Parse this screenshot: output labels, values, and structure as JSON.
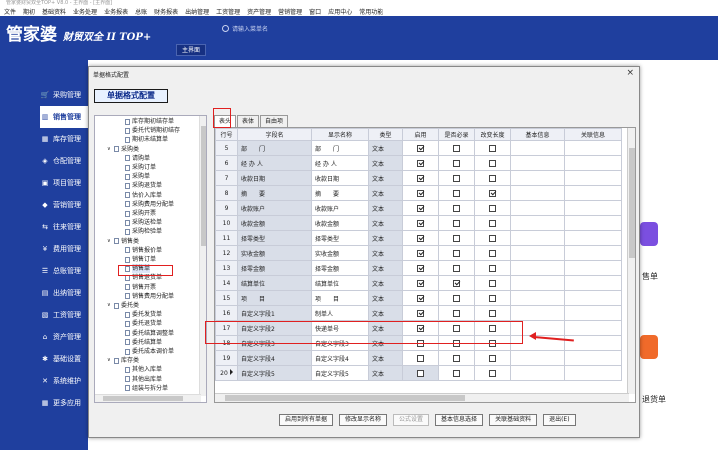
{
  "app": {
    "title": "管家婆财贸双全TOP+ V8.0 - 主界面 - [主界面]",
    "menu": [
      "文件",
      "期初",
      "基础资料",
      "业务处理",
      "业务报表",
      "总账",
      "财务报表",
      "出纳管理",
      "工资管理",
      "资产管理",
      "营销管理",
      "窗口",
      "应用中心",
      "常用功能"
    ],
    "logo": "管家婆",
    "logo_sub": "财贸双全 II TOP+",
    "search_placeholder": "请输入菜单名",
    "main_tab": "主界面"
  },
  "sidebar": {
    "items": [
      {
        "label": "采购管理",
        "icon": "cart-icon"
      },
      {
        "label": "销售管理",
        "icon": "chart-icon",
        "active": true
      },
      {
        "label": "库存管理",
        "icon": "box-icon"
      },
      {
        "label": "仓配管理",
        "icon": "warehouse-icon"
      },
      {
        "label": "项目管理",
        "icon": "project-icon"
      },
      {
        "label": "营销管理",
        "icon": "tag-icon"
      },
      {
        "label": "往来管理",
        "icon": "exchange-icon"
      },
      {
        "label": "费用管理",
        "icon": "money-icon"
      },
      {
        "label": "总账管理",
        "icon": "ledger-icon"
      },
      {
        "label": "出纳管理",
        "icon": "cashier-icon"
      },
      {
        "label": "工资管理",
        "icon": "salary-icon"
      },
      {
        "label": "资产管理",
        "icon": "asset-icon"
      },
      {
        "label": "基础设置",
        "icon": "settings-icon"
      },
      {
        "label": "系统维护",
        "icon": "tools-icon"
      },
      {
        "label": "更多应用",
        "icon": "grid-icon"
      }
    ]
  },
  "right_tiles": [
    {
      "label": "售单",
      "color": "#7b4fe0"
    },
    {
      "label": "退货单",
      "color": "#f06a2a"
    }
  ],
  "dialog": {
    "title": "单据格式配置",
    "header": "单据格式配置",
    "tabs": [
      "表头",
      "表体",
      "自由项"
    ],
    "tree": [
      {
        "label": "库存期初结存单",
        "level": 2
      },
      {
        "label": "委托代销期初结存",
        "level": 2
      },
      {
        "label": "期初未结算单",
        "level": 2
      },
      {
        "label": "采购类",
        "level": 1,
        "folder": true
      },
      {
        "label": "请购单",
        "level": 2
      },
      {
        "label": "采购订单",
        "level": 2
      },
      {
        "label": "采购单",
        "level": 2
      },
      {
        "label": "采购退货单",
        "level": 2
      },
      {
        "label": "估价入库单",
        "level": 2
      },
      {
        "label": "采购费用分配单",
        "level": 2
      },
      {
        "label": "采购开票",
        "level": 2
      },
      {
        "label": "采购送检单",
        "level": 2
      },
      {
        "label": "采购检验单",
        "level": 2
      },
      {
        "label": "销售类",
        "level": 1,
        "folder": true
      },
      {
        "label": "销售报价单",
        "level": 2
      },
      {
        "label": "销售订单",
        "level": 2
      },
      {
        "label": "销售单",
        "level": 2,
        "selected": true
      },
      {
        "label": "销售退货单",
        "level": 2
      },
      {
        "label": "销售开票",
        "level": 2
      },
      {
        "label": "销售费用分配单",
        "level": 2
      },
      {
        "label": "委托类",
        "level": 1,
        "folder": true
      },
      {
        "label": "委托发货单",
        "level": 2
      },
      {
        "label": "委托退货单",
        "level": 2
      },
      {
        "label": "委托结算调整单",
        "level": 2
      },
      {
        "label": "委托结算单",
        "level": 2
      },
      {
        "label": "委托成本调价单",
        "level": 2
      },
      {
        "label": "库存类",
        "level": 1,
        "folder": true
      },
      {
        "label": "其他入库单",
        "level": 2
      },
      {
        "label": "其他出库单",
        "level": 2
      },
      {
        "label": "组装与拆分单",
        "level": 2
      }
    ],
    "columns": [
      "行号",
      "字段名",
      "显示名称",
      "类型",
      "启用",
      "是否必录",
      "改变长度",
      "基本信息",
      "关联信息"
    ],
    "rows": [
      {
        "no": "5",
        "field": "部　　门",
        "display": "部　　门",
        "type": "文本",
        "enabled": true,
        "required": false,
        "len": false
      },
      {
        "no": "6",
        "field": "经 办 人",
        "display": "经 办 人",
        "type": "文本",
        "enabled": true,
        "required": false,
        "len": false
      },
      {
        "no": "7",
        "field": "收款日期",
        "display": "收款日期",
        "type": "文本",
        "enabled": true,
        "required": false,
        "len": false
      },
      {
        "no": "8",
        "field": "摘　　要",
        "display": "摘　　要",
        "type": "文本",
        "enabled": true,
        "required": false,
        "len": true
      },
      {
        "no": "9",
        "field": "收款账户",
        "display": "收款账户",
        "type": "文本",
        "enabled": true,
        "required": false,
        "len": false
      },
      {
        "no": "10",
        "field": "收款金额",
        "display": "收款金额",
        "type": "文本",
        "enabled": true,
        "required": false,
        "len": false
      },
      {
        "no": "11",
        "field": "择零类型",
        "display": "择零类型",
        "type": "文本",
        "enabled": true,
        "required": false,
        "len": false
      },
      {
        "no": "12",
        "field": "实收金额",
        "display": "实收金额",
        "type": "文本",
        "enabled": true,
        "required": false,
        "len": false
      },
      {
        "no": "13",
        "field": "择零金额",
        "display": "择零金额",
        "type": "文本",
        "enabled": true,
        "required": false,
        "len": false
      },
      {
        "no": "14",
        "field": "结算单位",
        "display": "结算单位",
        "type": "文本",
        "enabled": true,
        "required": true,
        "len": false
      },
      {
        "no": "15",
        "field": "项　　目",
        "display": "项　　目",
        "type": "文本",
        "enabled": true,
        "required": false,
        "len": false
      },
      {
        "no": "16",
        "field": "自定义字段1",
        "display": "制单人",
        "type": "文本",
        "enabled": true,
        "required": false,
        "len": false
      },
      {
        "no": "17",
        "field": "自定义字段2",
        "display": "快递单号",
        "type": "文本",
        "enabled": true,
        "required": false,
        "len": false
      },
      {
        "no": "18",
        "field": "自定义字段3",
        "display": "自定义字段3",
        "type": "文本",
        "enabled": false,
        "required": false,
        "len": false
      },
      {
        "no": "19",
        "field": "自定义字段4",
        "display": "自定义字段4",
        "type": "文本",
        "enabled": false,
        "required": false,
        "len": false
      },
      {
        "no": "20",
        "field": "自定义字段5",
        "display": "自定义字段5",
        "type": "文本",
        "enabled": false,
        "required": false,
        "len": false,
        "current": true
      }
    ],
    "buttons": [
      {
        "label": "启用到所有单据",
        "disabled": false
      },
      {
        "label": "修改显示名称",
        "disabled": false
      },
      {
        "label": "公式设置",
        "disabled": true
      },
      {
        "label": "基本信息选择",
        "disabled": false
      },
      {
        "label": "关联基础资料",
        "disabled": false
      },
      {
        "label": "退出(E)",
        "disabled": false
      }
    ]
  }
}
